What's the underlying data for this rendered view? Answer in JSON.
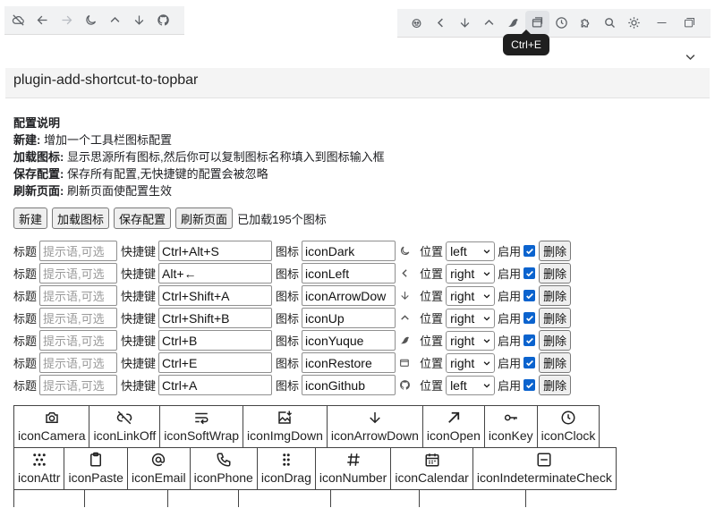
{
  "topbar_left": {
    "icons": [
      "cloud-off-icon",
      "back-arrow-icon",
      "forward-arrow-icon",
      "moon-icon",
      "arrow-up-icon",
      "arrow-down-icon",
      "github-icon"
    ]
  },
  "topbar_right": {
    "icons": [
      "plugin-icon",
      "chevron-left-icon",
      "arrow-down-icon",
      "chevron-up-icon",
      "yuque-icon",
      "restore-icon",
      "clock-icon",
      "puzzle-icon",
      "search-icon",
      "sun-icon",
      "minimize-icon",
      "maximize-icon"
    ],
    "tooltip": "Ctrl+E"
  },
  "panel": {
    "title": "plugin-add-shortcut-to-topbar"
  },
  "desc": {
    "heading": "配置说明",
    "lines": [
      {
        "key": "新建:",
        "text": " 增加一个工具栏图标配置"
      },
      {
        "key": "加载图标:",
        "text": " 显示思源所有图标,然后你可以复制图标名称填入到图标输入框"
      },
      {
        "key": "保存配置:",
        "text": " 保存所有配置,无快捷键的配置会被忽略"
      },
      {
        "key": "刷新页面:",
        "text": " 刷新页面使配置生效"
      }
    ]
  },
  "actions": {
    "new_label": "新建",
    "load_label": "加载图标",
    "save_label": "保存配置",
    "refresh_label": "刷新页面",
    "loaded_text": "已加载195个图标"
  },
  "row_labels": {
    "title": "标题",
    "shortcut": "快捷键",
    "icon": "图标",
    "position": "位置",
    "enable": "启用",
    "delete": "删除",
    "title_placeholder": "提示语,可选"
  },
  "rows": [
    {
      "shortcut": "Ctrl+Alt+S",
      "icon_name": "iconDark",
      "icon": "moon-icon",
      "position": "left",
      "enabled": true
    },
    {
      "shortcut": "Alt+←",
      "icon_name": "iconLeft",
      "icon": "chevron-left-icon",
      "position": "right",
      "enabled": true
    },
    {
      "shortcut": "Ctrl+Shift+A",
      "icon_name": "iconArrowDow",
      "icon": "arrow-down-icon",
      "position": "right",
      "enabled": true
    },
    {
      "shortcut": "Ctrl+Shift+B",
      "icon_name": "iconUp",
      "icon": "chevron-up-icon",
      "position": "right",
      "enabled": true
    },
    {
      "shortcut": "Ctrl+B",
      "icon_name": "iconYuque",
      "icon": "yuque-icon",
      "position": "right",
      "enabled": true
    },
    {
      "shortcut": "Ctrl+E",
      "icon_name": "iconRestore",
      "icon": "restore-icon",
      "position": "right",
      "enabled": true
    },
    {
      "shortcut": "Ctrl+A",
      "icon_name": "iconGithub",
      "icon": "github-icon",
      "position": "left",
      "enabled": true
    }
  ],
  "icon_grid": {
    "row1": [
      {
        "name": "iconCamera",
        "icon": "camera-icon"
      },
      {
        "name": "iconLinkOff",
        "icon": "link-off-icon"
      },
      {
        "name": "iconSoftWrap",
        "icon": "soft-wrap-icon"
      },
      {
        "name": "iconImgDown",
        "icon": "image-down-icon"
      },
      {
        "name": "iconArrowDown",
        "icon": "arrow-down-icon"
      },
      {
        "name": "iconOpen",
        "icon": "open-icon"
      },
      {
        "name": "iconKey",
        "icon": "key-icon"
      },
      {
        "name": "iconClock",
        "icon": "clock-icon"
      }
    ],
    "row2": [
      {
        "name": "iconAttr",
        "icon": "attr-icon"
      },
      {
        "name": "iconPaste",
        "icon": "paste-icon"
      },
      {
        "name": "iconEmail",
        "icon": "email-icon"
      },
      {
        "name": "iconPhone",
        "icon": "phone-icon"
      },
      {
        "name": "iconDrag",
        "icon": "drag-icon"
      },
      {
        "name": "iconNumber",
        "icon": "number-icon"
      },
      {
        "name": "iconCalendar",
        "icon": "calendar-icon"
      },
      {
        "name": "iconIndeterminateCheck",
        "icon": "indeterminate-check-icon"
      }
    ]
  }
}
